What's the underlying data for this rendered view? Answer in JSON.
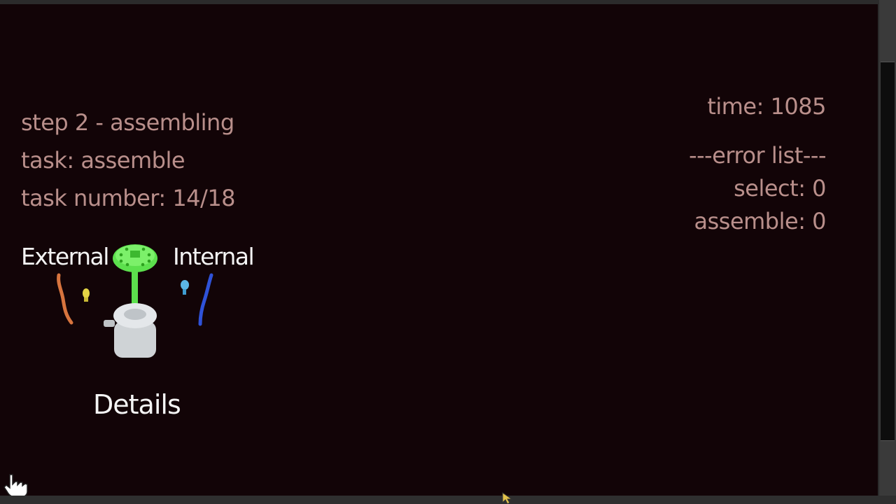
{
  "hud": {
    "step_title": "step 2 - assembling",
    "task_label": "task: assemble",
    "task_number": "task number:  14/18",
    "timer": "time: 1085",
    "error_header": "---error list---",
    "error_select": "select: 0",
    "error_assemble": "assemble:  0"
  },
  "parts_panel": {
    "external_label": "External",
    "internal_label": "Internal",
    "details_button": "Details"
  },
  "colors": {
    "background": "#120407",
    "hud_text": "#b98f8b",
    "label_text": "#f4f4f4",
    "external_tube": "#d7743e",
    "external_connector": "#e3d445",
    "internal_tube": "#2f52d8",
    "internal_connector": "#5bb6e6",
    "stand": "#5ce04d",
    "base": "#cfd3d6"
  },
  "icons": {
    "cursor": "hand-pointer-icon",
    "bottom_marker": "arrow-pointer-icon"
  }
}
